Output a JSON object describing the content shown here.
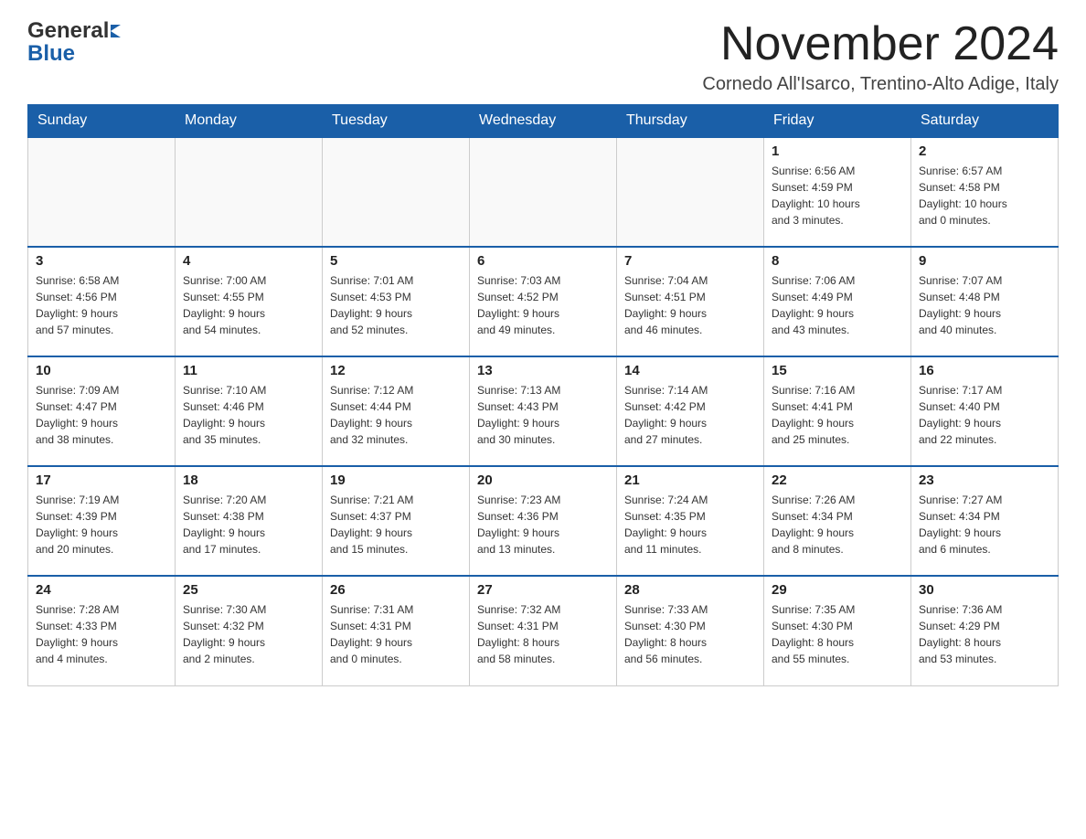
{
  "header": {
    "logo_general": "General",
    "logo_blue": "Blue",
    "month_title": "November 2024",
    "location": "Cornedo All'Isarco, Trentino-Alto Adige, Italy"
  },
  "weekdays": [
    "Sunday",
    "Monday",
    "Tuesday",
    "Wednesday",
    "Thursday",
    "Friday",
    "Saturday"
  ],
  "weeks": [
    [
      {
        "day": "",
        "info": ""
      },
      {
        "day": "",
        "info": ""
      },
      {
        "day": "",
        "info": ""
      },
      {
        "day": "",
        "info": ""
      },
      {
        "day": "",
        "info": ""
      },
      {
        "day": "1",
        "info": "Sunrise: 6:56 AM\nSunset: 4:59 PM\nDaylight: 10 hours\nand 3 minutes."
      },
      {
        "day": "2",
        "info": "Sunrise: 6:57 AM\nSunset: 4:58 PM\nDaylight: 10 hours\nand 0 minutes."
      }
    ],
    [
      {
        "day": "3",
        "info": "Sunrise: 6:58 AM\nSunset: 4:56 PM\nDaylight: 9 hours\nand 57 minutes."
      },
      {
        "day": "4",
        "info": "Sunrise: 7:00 AM\nSunset: 4:55 PM\nDaylight: 9 hours\nand 54 minutes."
      },
      {
        "day": "5",
        "info": "Sunrise: 7:01 AM\nSunset: 4:53 PM\nDaylight: 9 hours\nand 52 minutes."
      },
      {
        "day": "6",
        "info": "Sunrise: 7:03 AM\nSunset: 4:52 PM\nDaylight: 9 hours\nand 49 minutes."
      },
      {
        "day": "7",
        "info": "Sunrise: 7:04 AM\nSunset: 4:51 PM\nDaylight: 9 hours\nand 46 minutes."
      },
      {
        "day": "8",
        "info": "Sunrise: 7:06 AM\nSunset: 4:49 PM\nDaylight: 9 hours\nand 43 minutes."
      },
      {
        "day": "9",
        "info": "Sunrise: 7:07 AM\nSunset: 4:48 PM\nDaylight: 9 hours\nand 40 minutes."
      }
    ],
    [
      {
        "day": "10",
        "info": "Sunrise: 7:09 AM\nSunset: 4:47 PM\nDaylight: 9 hours\nand 38 minutes."
      },
      {
        "day": "11",
        "info": "Sunrise: 7:10 AM\nSunset: 4:46 PM\nDaylight: 9 hours\nand 35 minutes."
      },
      {
        "day": "12",
        "info": "Sunrise: 7:12 AM\nSunset: 4:44 PM\nDaylight: 9 hours\nand 32 minutes."
      },
      {
        "day": "13",
        "info": "Sunrise: 7:13 AM\nSunset: 4:43 PM\nDaylight: 9 hours\nand 30 minutes."
      },
      {
        "day": "14",
        "info": "Sunrise: 7:14 AM\nSunset: 4:42 PM\nDaylight: 9 hours\nand 27 minutes."
      },
      {
        "day": "15",
        "info": "Sunrise: 7:16 AM\nSunset: 4:41 PM\nDaylight: 9 hours\nand 25 minutes."
      },
      {
        "day": "16",
        "info": "Sunrise: 7:17 AM\nSunset: 4:40 PM\nDaylight: 9 hours\nand 22 minutes."
      }
    ],
    [
      {
        "day": "17",
        "info": "Sunrise: 7:19 AM\nSunset: 4:39 PM\nDaylight: 9 hours\nand 20 minutes."
      },
      {
        "day": "18",
        "info": "Sunrise: 7:20 AM\nSunset: 4:38 PM\nDaylight: 9 hours\nand 17 minutes."
      },
      {
        "day": "19",
        "info": "Sunrise: 7:21 AM\nSunset: 4:37 PM\nDaylight: 9 hours\nand 15 minutes."
      },
      {
        "day": "20",
        "info": "Sunrise: 7:23 AM\nSunset: 4:36 PM\nDaylight: 9 hours\nand 13 minutes."
      },
      {
        "day": "21",
        "info": "Sunrise: 7:24 AM\nSunset: 4:35 PM\nDaylight: 9 hours\nand 11 minutes."
      },
      {
        "day": "22",
        "info": "Sunrise: 7:26 AM\nSunset: 4:34 PM\nDaylight: 9 hours\nand 8 minutes."
      },
      {
        "day": "23",
        "info": "Sunrise: 7:27 AM\nSunset: 4:34 PM\nDaylight: 9 hours\nand 6 minutes."
      }
    ],
    [
      {
        "day": "24",
        "info": "Sunrise: 7:28 AM\nSunset: 4:33 PM\nDaylight: 9 hours\nand 4 minutes."
      },
      {
        "day": "25",
        "info": "Sunrise: 7:30 AM\nSunset: 4:32 PM\nDaylight: 9 hours\nand 2 minutes."
      },
      {
        "day": "26",
        "info": "Sunrise: 7:31 AM\nSunset: 4:31 PM\nDaylight: 9 hours\nand 0 minutes."
      },
      {
        "day": "27",
        "info": "Sunrise: 7:32 AM\nSunset: 4:31 PM\nDaylight: 8 hours\nand 58 minutes."
      },
      {
        "day": "28",
        "info": "Sunrise: 7:33 AM\nSunset: 4:30 PM\nDaylight: 8 hours\nand 56 minutes."
      },
      {
        "day": "29",
        "info": "Sunrise: 7:35 AM\nSunset: 4:30 PM\nDaylight: 8 hours\nand 55 minutes."
      },
      {
        "day": "30",
        "info": "Sunrise: 7:36 AM\nSunset: 4:29 PM\nDaylight: 8 hours\nand 53 minutes."
      }
    ]
  ]
}
